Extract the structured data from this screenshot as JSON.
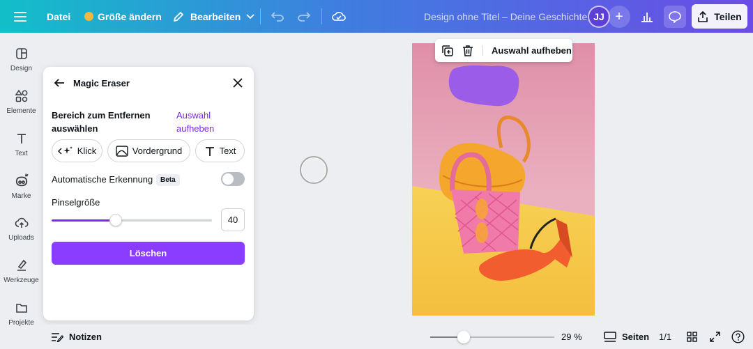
{
  "topbar": {
    "file_label": "Datei",
    "resize_label": "Größe ändern",
    "edit_label": "Bearbeiten",
    "doc_title": "Design ohne Titel – Deine Geschichte",
    "avatar_initials": "JJ",
    "share_label": "Teilen"
  },
  "rail": {
    "items": [
      {
        "label": "Design",
        "icon": "layout-icon"
      },
      {
        "label": "Elemente",
        "icon": "shapes-icon"
      },
      {
        "label": "Text",
        "icon": "text-icon"
      },
      {
        "label": "Marke",
        "icon": "brand-icon"
      },
      {
        "label": "Uploads",
        "icon": "upload-cloud-icon"
      },
      {
        "label": "Werkzeuge",
        "icon": "draw-icon"
      },
      {
        "label": "Projekte",
        "icon": "folder-icon"
      }
    ]
  },
  "panel": {
    "title": "Magic Eraser",
    "section_label": "Bereich zum Entfernen auswählen",
    "deselect_link": "Auswahl aufheben",
    "modes": [
      {
        "label": "Klick",
        "icon": "sparkle-click-icon"
      },
      {
        "label": "Vordergrund",
        "icon": "image-foreground-icon"
      },
      {
        "label": "Text",
        "icon": "text-icon"
      }
    ],
    "auto_detect_label": "Automatische Erkennung",
    "beta_badge": "Beta",
    "auto_detect_on": false,
    "brush_size_label": "Pinselgröße",
    "brush_size_value": "40",
    "brush_size_fraction": 0.4,
    "erase_button": "Löschen"
  },
  "selection_toolbar": {
    "deselect_label": "Auswahl aufheben"
  },
  "bottombar": {
    "notes_label": "Notizen",
    "zoom_label": "29 %",
    "zoom_fraction": 0.27,
    "pages_label": "Seiten",
    "page_count": "1/1"
  },
  "colors": {
    "accent": "#8b3dff",
    "link": "#7d2ae8",
    "brush_mark": "#9b5ce8"
  }
}
